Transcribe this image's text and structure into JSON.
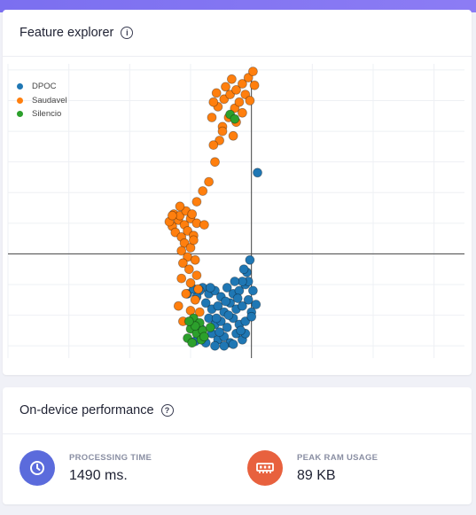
{
  "explorer": {
    "title": "Feature explorer",
    "help_icon": "info-icon"
  },
  "performance": {
    "title": "On-device performance",
    "help_icon": "help-circle-icon",
    "metrics": [
      {
        "label": "PROCESSING TIME",
        "value": "1490 ms.",
        "icon": "clock-icon",
        "color": "#5b6bdc"
      },
      {
        "label": "PEAK RAM USAGE",
        "value": "89 KB",
        "icon": "memory-chip-icon",
        "color": "#e8613e"
      }
    ]
  },
  "chart_data": {
    "type": "scatter",
    "title": "",
    "xlabel": "",
    "ylabel": "",
    "xlim": [
      -8,
      7
    ],
    "ylim": [
      -3.4,
      6.2
    ],
    "grid": true,
    "legend_position": "top-left",
    "series": [
      {
        "name": "DPOC",
        "color": "#1f77b4",
        "points": [
          [
            -1.6,
            -1.1
          ],
          [
            -1.4,
            -1.3
          ],
          [
            -1.2,
            -1.2
          ],
          [
            -1.0,
            -1.4
          ],
          [
            -0.8,
            -1.1
          ],
          [
            -0.6,
            -1.3
          ],
          [
            -0.4,
            -1.2
          ],
          [
            -0.2,
            -1.0
          ],
          [
            -1.5,
            -1.6
          ],
          [
            -1.3,
            -1.8
          ],
          [
            -1.1,
            -1.7
          ],
          [
            -0.9,
            -1.9
          ],
          [
            -0.7,
            -1.6
          ],
          [
            -0.5,
            -1.8
          ],
          [
            -0.3,
            -1.7
          ],
          [
            -0.1,
            -1.5
          ],
          [
            -1.4,
            -2.1
          ],
          [
            -1.2,
            -2.3
          ],
          [
            -1.0,
            -2.2
          ],
          [
            -0.8,
            -2.4
          ],
          [
            -0.6,
            -2.1
          ],
          [
            -0.4,
            -2.3
          ],
          [
            -0.2,
            -2.2
          ],
          [
            0.0,
            -1.9
          ],
          [
            -1.3,
            -2.6
          ],
          [
            -1.1,
            -2.8
          ],
          [
            -0.9,
            -2.7
          ],
          [
            -0.7,
            -2.9
          ],
          [
            -0.5,
            -2.6
          ],
          [
            -0.3,
            -2.8
          ],
          [
            -1.5,
            -2.9
          ],
          [
            -1.2,
            -3.0
          ],
          [
            -0.9,
            -3.0
          ],
          [
            -0.6,
            -2.95
          ],
          [
            -0.2,
            -2.6
          ],
          [
            0.05,
            -1.2
          ],
          [
            -0.1,
            -0.9
          ],
          [
            -0.3,
            -0.9
          ],
          [
            -0.15,
            -0.6
          ],
          [
            -0.55,
            -0.9
          ],
          [
            -1.7,
            -1.2
          ],
          [
            -1.8,
            -1.4
          ],
          [
            -0.35,
            -2.5
          ],
          [
            -0.75,
            -2.0
          ],
          [
            -1.05,
            -2.55
          ],
          [
            0.15,
            -1.65
          ],
          [
            0.0,
            -2.05
          ],
          [
            -0.45,
            -1.45
          ],
          [
            -2.1,
            -1.3
          ],
          [
            -1.9,
            -1.15
          ],
          [
            -1.65,
            -2.45
          ],
          [
            -0.05,
            -0.2
          ],
          [
            -0.25,
            -0.5
          ],
          [
            -1.35,
            -1.1
          ],
          [
            -0.85,
            -1.55
          ],
          [
            -1.15,
            -2.1
          ],
          [
            -1.85,
            -2.85
          ],
          [
            0.2,
            2.65
          ]
        ]
      },
      {
        "name": "Saudavel",
        "color": "#ff7f0e",
        "points": [
          [
            -2.6,
            0.9
          ],
          [
            -2.4,
            1.1
          ],
          [
            -2.2,
            0.95
          ],
          [
            -2.0,
            1.15
          ],
          [
            -1.8,
            1.0
          ],
          [
            -2.5,
            0.7
          ],
          [
            -2.3,
            0.55
          ],
          [
            -2.1,
            0.75
          ],
          [
            -1.9,
            0.6
          ],
          [
            -2.7,
            1.05
          ],
          [
            -2.55,
            1.3
          ],
          [
            -2.35,
            1.25
          ],
          [
            -2.15,
            1.4
          ],
          [
            -1.95,
            1.3
          ],
          [
            -2.2,
            0.35
          ],
          [
            -2.0,
            0.2
          ],
          [
            -2.3,
            0.1
          ],
          [
            -1.9,
            0.45
          ],
          [
            -2.1,
            -0.1
          ],
          [
            -1.85,
            -0.2
          ],
          [
            -2.25,
            -0.3
          ],
          [
            -2.05,
            -0.5
          ],
          [
            -1.8,
            -0.7
          ],
          [
            -2.3,
            -0.8
          ],
          [
            -2.0,
            -0.95
          ],
          [
            -1.75,
            -1.15
          ],
          [
            -2.15,
            -1.3
          ],
          [
            -1.85,
            -1.5
          ],
          [
            -2.4,
            -1.7
          ],
          [
            -2.0,
            -1.85
          ],
          [
            -1.7,
            -1.9
          ],
          [
            -2.25,
            -2.2
          ],
          [
            -1.8,
            1.7
          ],
          [
            -1.6,
            2.05
          ],
          [
            -1.4,
            2.35
          ],
          [
            -1.2,
            3.0
          ],
          [
            -1.05,
            3.7
          ],
          [
            -0.95,
            4.15
          ],
          [
            -1.3,
            4.45
          ],
          [
            -1.1,
            4.8
          ],
          [
            -0.9,
            5.05
          ],
          [
            -0.7,
            5.2
          ],
          [
            -0.5,
            5.35
          ],
          [
            -0.3,
            5.55
          ],
          [
            -0.1,
            5.75
          ],
          [
            0.05,
            5.95
          ],
          [
            -0.2,
            5.2
          ],
          [
            -0.55,
            4.75
          ],
          [
            -0.75,
            4.45
          ],
          [
            -0.95,
            4.0
          ],
          [
            -0.5,
            4.3
          ],
          [
            -0.3,
            4.6
          ],
          [
            -0.05,
            5.0
          ],
          [
            0.1,
            5.5
          ],
          [
            -0.65,
            5.7
          ],
          [
            -0.85,
            5.45
          ],
          [
            -1.15,
            5.25
          ],
          [
            -1.25,
            4.95
          ],
          [
            -0.4,
            4.95
          ],
          [
            -0.6,
            3.85
          ],
          [
            -1.25,
            3.55
          ],
          [
            -2.35,
            1.55
          ],
          [
            -2.6,
            1.25
          ],
          [
            -1.55,
            0.95
          ]
        ]
      },
      {
        "name": "Silencio",
        "color": "#2ca02c",
        "points": [
          [
            -1.9,
            -2.1
          ],
          [
            -1.7,
            -2.25
          ],
          [
            -2.0,
            -2.45
          ],
          [
            -1.8,
            -2.6
          ],
          [
            -2.1,
            -2.75
          ],
          [
            -1.95,
            -2.9
          ],
          [
            -1.65,
            -2.8
          ],
          [
            -1.85,
            -2.35
          ],
          [
            -2.05,
            -2.2
          ],
          [
            -1.6,
            -2.5
          ],
          [
            -1.35,
            -2.4
          ],
          [
            -1.55,
            -2.7
          ],
          [
            -0.7,
            4.55
          ],
          [
            -0.55,
            4.4
          ]
        ]
      }
    ]
  }
}
